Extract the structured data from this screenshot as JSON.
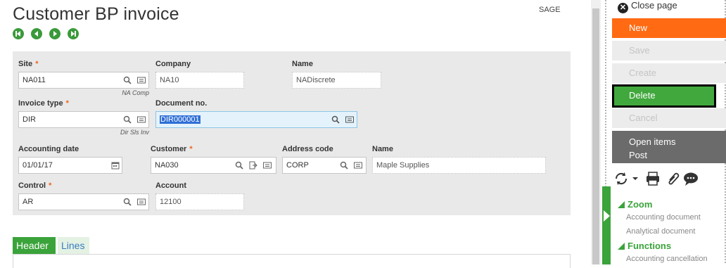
{
  "page": {
    "title": "Customer BP invoice",
    "folder": "SAGE"
  },
  "nav": [
    "first",
    "previous",
    "next",
    "last"
  ],
  "form": {
    "site": {
      "label": "Site",
      "value": "NA011",
      "sub": "NA Comp"
    },
    "company": {
      "label": "Company",
      "value": "NA10"
    },
    "name1": {
      "label": "Name",
      "value": "NADiscrete"
    },
    "invoice_type": {
      "label": "Invoice type",
      "value": "DIR",
      "sub": "Dir Sls Inv"
    },
    "document_no": {
      "label": "Document no.",
      "value": "DIR000001"
    },
    "accounting_date": {
      "label": "Accounting date",
      "value": "01/01/17"
    },
    "customer": {
      "label": "Customer",
      "value": "NA030"
    },
    "address_code": {
      "label": "Address code",
      "value": "CORP"
    },
    "name2": {
      "label": "Name",
      "value": "Maple Supplies"
    },
    "control": {
      "label": "Control",
      "value": "AR"
    },
    "account": {
      "label": "Account",
      "value": "12100"
    },
    "required_mark": "*"
  },
  "tabs": {
    "header": "Header",
    "lines": "Lines"
  },
  "sidebar": {
    "close_page": "Close page",
    "new": "New",
    "save": "Save",
    "create": "Create",
    "delete": "Delete",
    "cancel": "Cancel",
    "open_items": "Open items",
    "post": "Post",
    "zoom": "Zoom",
    "zoom_items": [
      "Accounting document",
      "Analytical document"
    ],
    "functions": "Functions",
    "function_items": [
      "Accounting cancellation"
    ]
  },
  "colors": {
    "accent_green": "#3aa33a",
    "new_orange": "#ff6a13",
    "required_orange": "#f06522",
    "open_items_gray": "#6b6b6b"
  },
  "icons": [
    "zoom-lookup-icon",
    "selection-list-icon",
    "calendar-icon",
    "tunnel-icon",
    "refresh-icon",
    "printer-icon",
    "paperclip-icon",
    "comment-icon",
    "close-icon"
  ]
}
